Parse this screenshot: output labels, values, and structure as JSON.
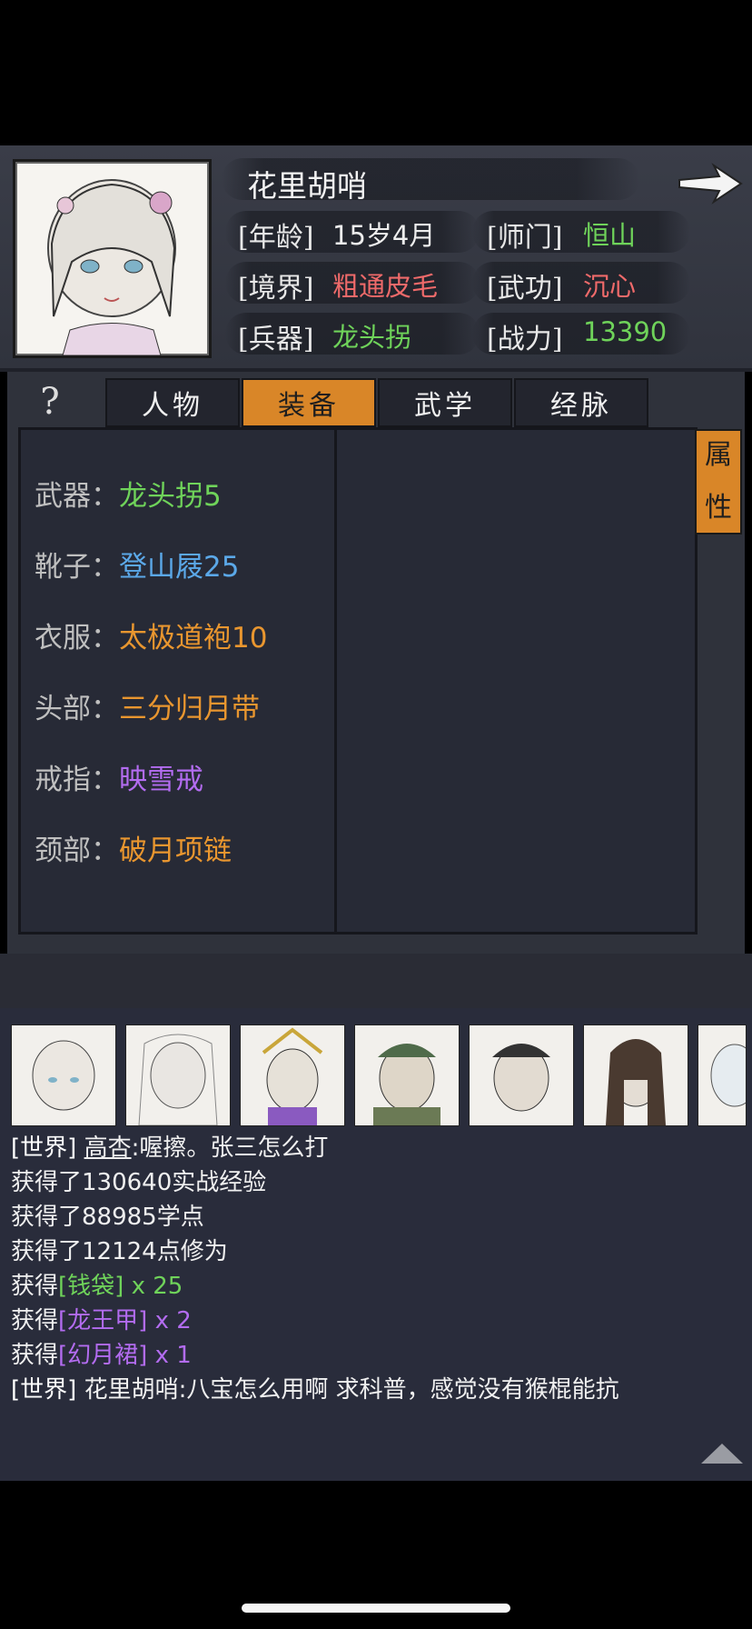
{
  "character": {
    "name": "花里胡哨",
    "fields": {
      "age_label": "[年龄]",
      "age_value": "15岁4月",
      "sect_label": "[师门]",
      "sect_value": "恒山",
      "realm_label": "[境界]",
      "realm_value": "粗通皮毛",
      "skill_label": "[武功]",
      "skill_value": "沉心",
      "weapon_label": "[兵器]",
      "weapon_value": "龙头拐",
      "power_label": "[战力]",
      "power_value": "13390"
    }
  },
  "tabs": {
    "help": "?",
    "items": [
      "人物",
      "装备",
      "武学",
      "经脉"
    ],
    "active": "装备"
  },
  "equipment": [
    {
      "slot": "武器：",
      "item": "龙头拐5",
      "color": "green"
    },
    {
      "slot": "靴子：",
      "item": "登山屐25",
      "color": "blue"
    },
    {
      "slot": "衣服：",
      "item": "太极道袍10",
      "color": "orange"
    },
    {
      "slot": "头部：",
      "item": "三分归月带",
      "color": "orange"
    },
    {
      "slot": "戒指：",
      "item": "映雪戒",
      "color": "purple"
    },
    {
      "slot": "颈部：",
      "item": "破月项链",
      "color": "orange"
    }
  ],
  "attr_button": {
    "line1": "属",
    "line2": "性"
  },
  "chat": {
    "line1_tag": "[世界]",
    "line1_user": "高杏",
    "line1_text": ":喔擦。张三怎么打",
    "line2": "获得了130640实战经验",
    "line3": "获得了88985学点",
    "line4": "获得了12124点修为",
    "line5_pre": "获得",
    "line5_item": "[钱袋]",
    "line5_qty": " x 25",
    "line6_pre": "获得",
    "line6_item": "[龙王甲]",
    "line6_qty": " x 2",
    "line7_pre": "获得",
    "line7_item": "[幻月裙]",
    "line7_qty": " x 1",
    "line8_tag": "[世界]",
    "line8_user": "花里胡哨",
    "line8_text": ":八宝怎么用啊 求科普，感觉没有猴棍能抗"
  },
  "colors": {
    "accent_orange": "#d98628",
    "green": "#6fd35a",
    "red": "#ef6a6a",
    "blue": "#5ba8e8",
    "orange": "#e9962f",
    "purple": "#b36cf0"
  }
}
